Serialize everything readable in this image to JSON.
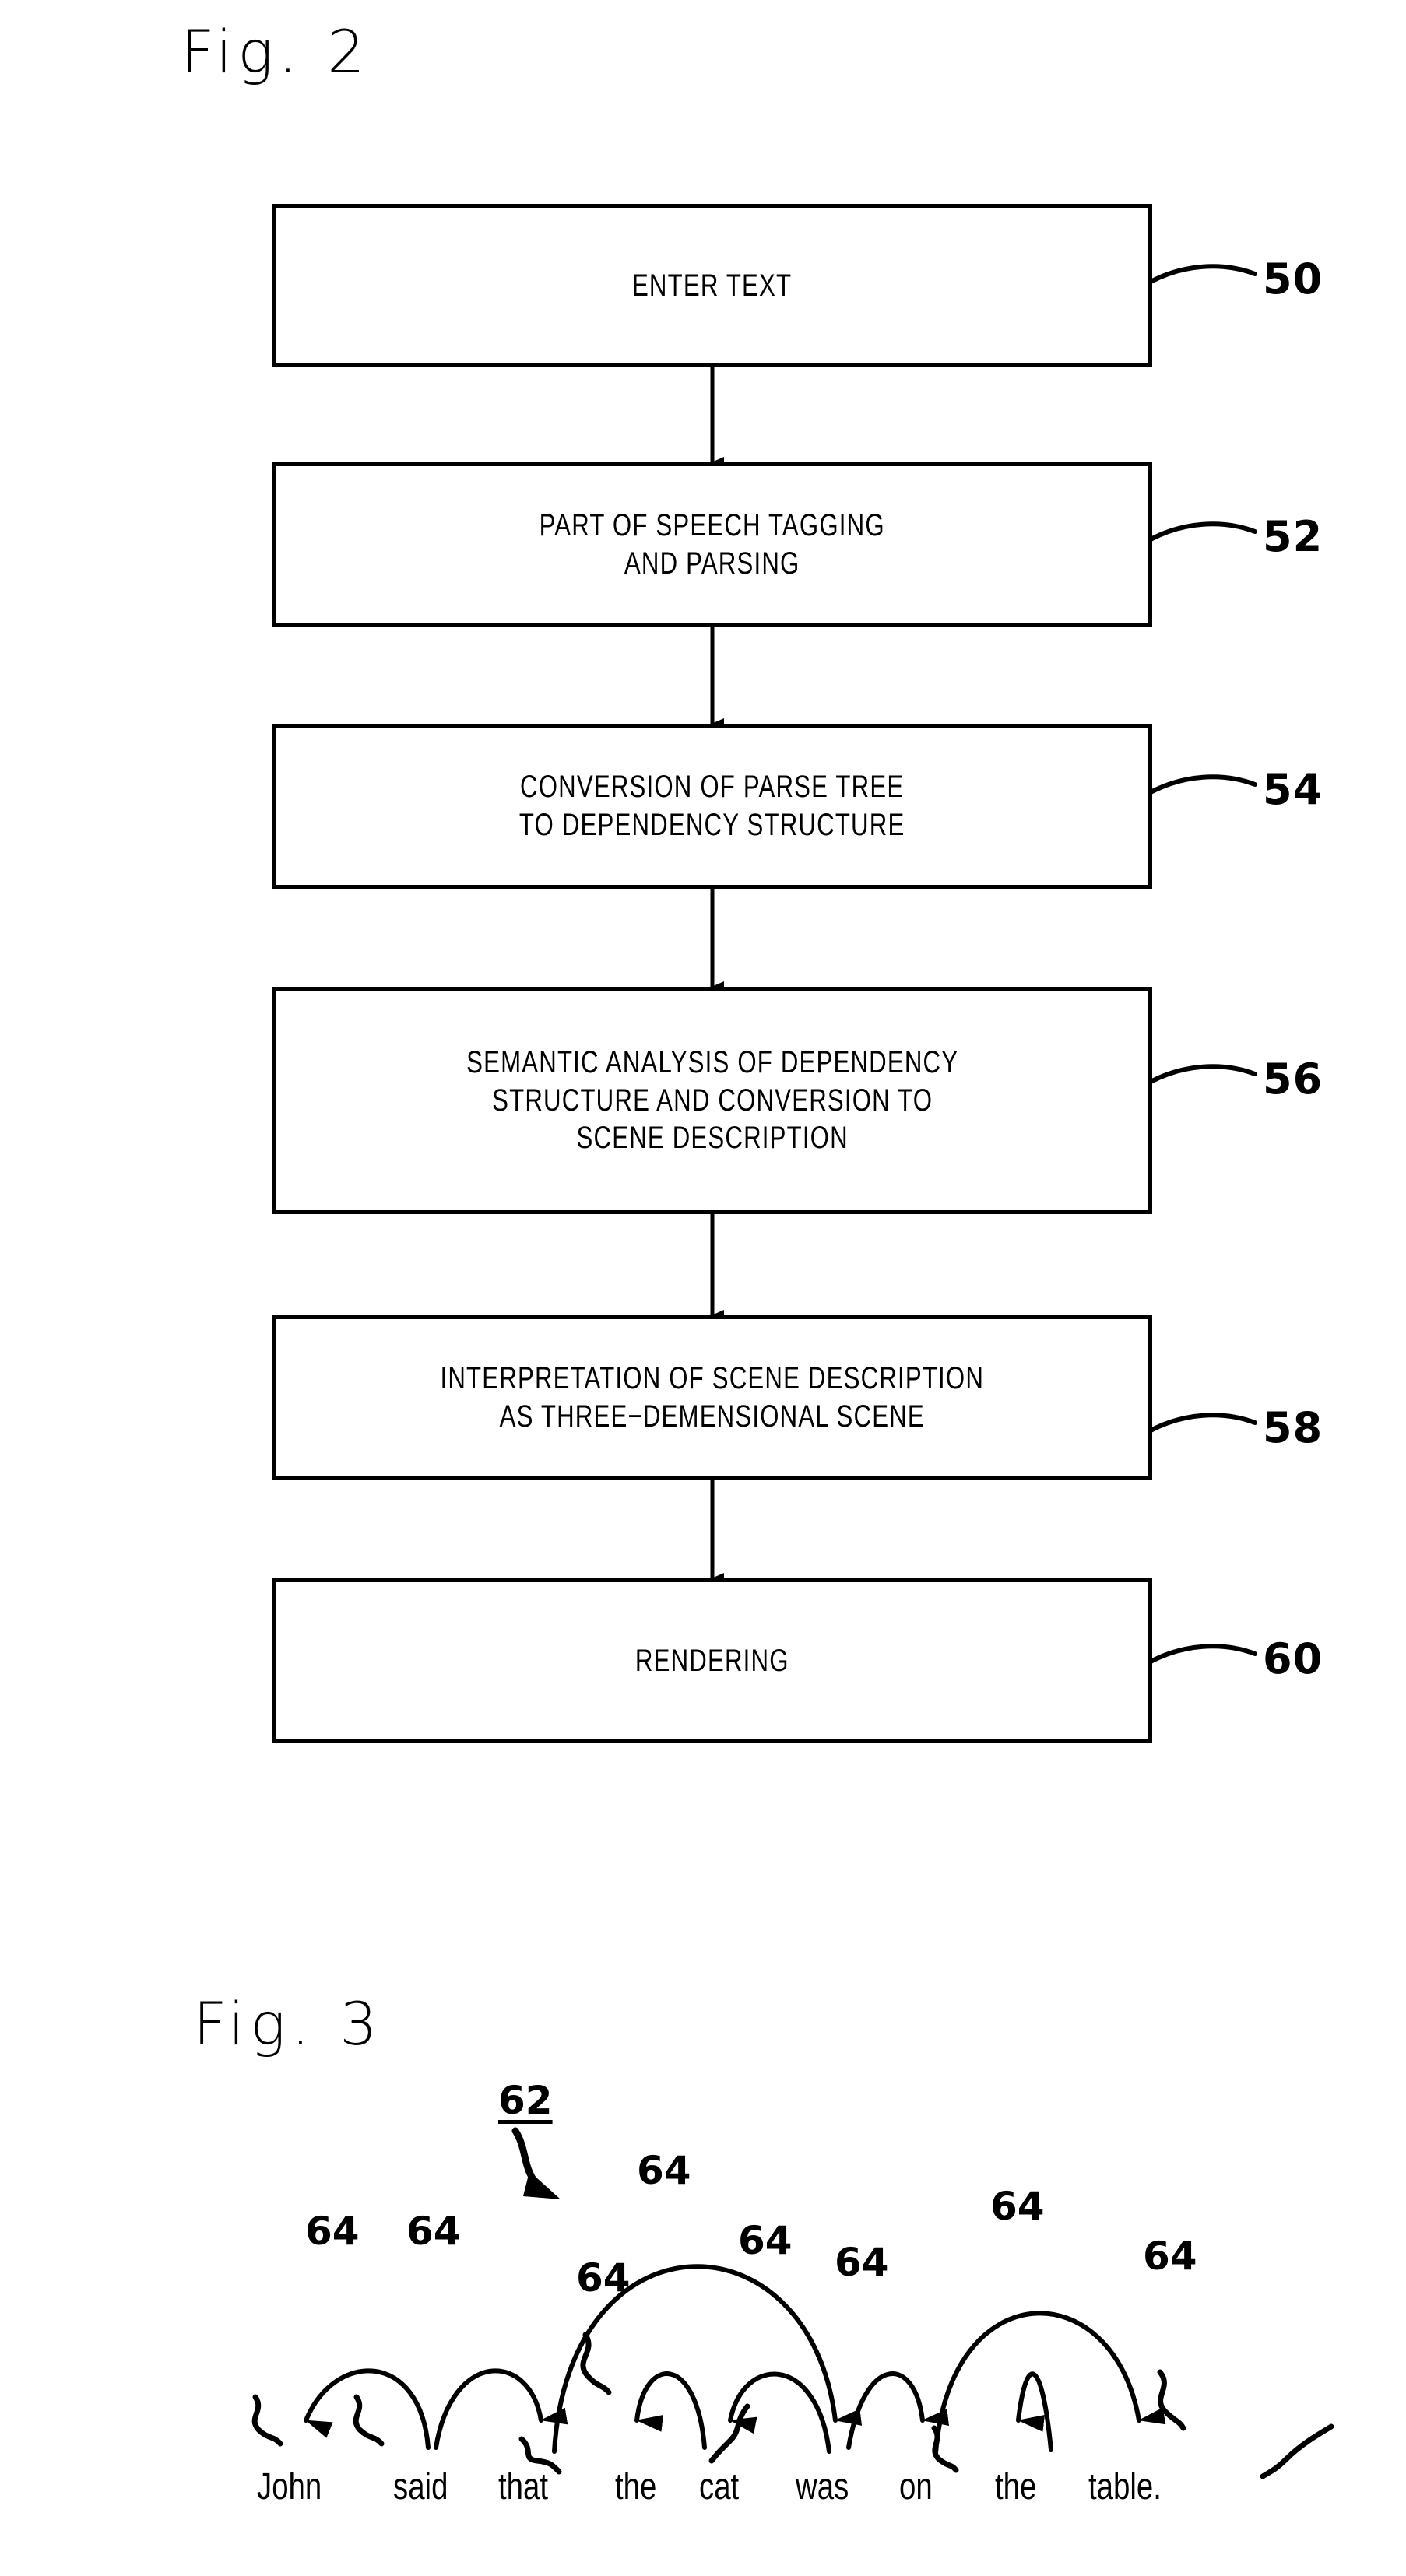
{
  "figures": [
    {
      "id": "fig2",
      "label": "Fig. 2",
      "type": "flowchart",
      "steps": [
        {
          "ref": "50",
          "lines": [
            "ENTER TEXT"
          ]
        },
        {
          "ref": "52",
          "lines": [
            "PART OF SPEECH TAGGING",
            "AND PARSING"
          ]
        },
        {
          "ref": "54",
          "lines": [
            "CONVERSION OF PARSE TREE",
            "TO DEPENDENCY STRUCTURE"
          ]
        },
        {
          "ref": "56",
          "lines": [
            "SEMANTIC ANALYSIS OF DEPENDENCY",
            "STRUCTURE AND CONVERSION TO",
            "SCENE DESCRIPTION"
          ]
        },
        {
          "ref": "58",
          "lines": [
            "INTERPRETATION OF SCENE DESCRIPTION",
            "AS THREE−DEMENSIONAL SCENE"
          ]
        },
        {
          "ref": "60",
          "lines": [
            "RENDERING"
          ]
        }
      ]
    },
    {
      "id": "fig3",
      "label": "Fig. 3",
      "type": "dependency-arc-diagram",
      "structure_ref": "62",
      "arc_ref": "64",
      "sentence": "John said that the cat was on the table.",
      "words": [
        "John",
        "said",
        "that",
        "the",
        "cat",
        "was",
        "on",
        "the",
        "table."
      ],
      "arc_labels": [
        "64",
        "64",
        "64",
        "64",
        "64",
        "64",
        "64",
        "64",
        "64"
      ],
      "dependencies": [
        {
          "head": "said",
          "dependent": "John"
        },
        {
          "head": "said",
          "dependent": "that"
        },
        {
          "head": "that",
          "dependent": "was"
        },
        {
          "head": "cat",
          "dependent": "the"
        },
        {
          "head": "was",
          "dependent": "cat"
        },
        {
          "head": "was",
          "dependent": "on"
        },
        {
          "head": "on",
          "dependent": "table."
        },
        {
          "head": "table.",
          "dependent": "the"
        }
      ]
    }
  ],
  "colors": {
    "ink": "#000000",
    "paper": "#ffffff"
  }
}
